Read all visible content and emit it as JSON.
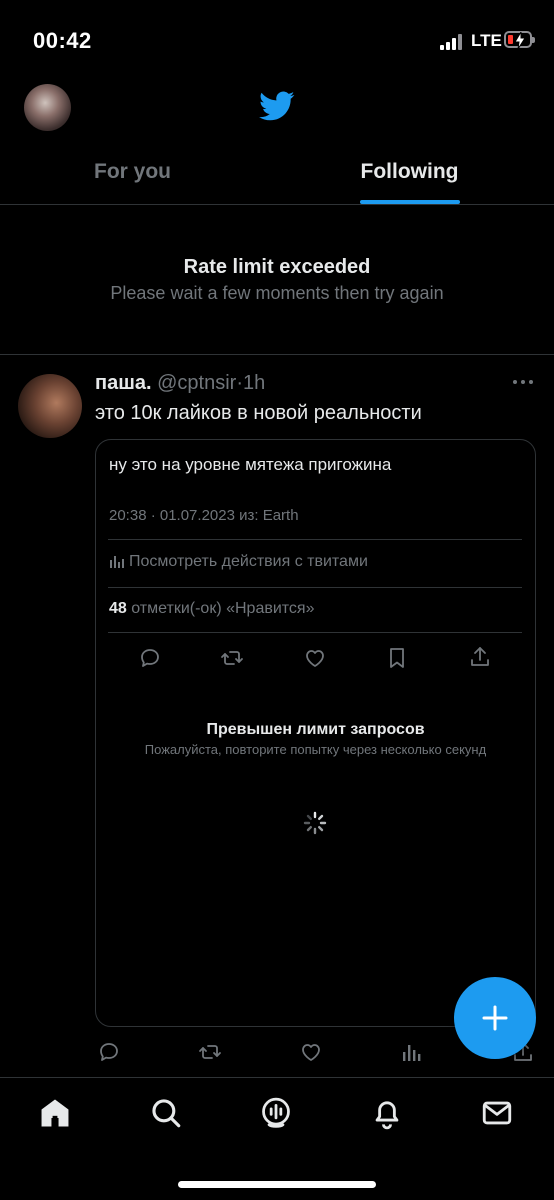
{
  "status_bar": {
    "time": "00:42",
    "network": "LTE",
    "icons": [
      "signal-icon",
      "battery-charging-icon"
    ]
  },
  "header": {
    "logo": "twitter-bird-icon",
    "avatar": "profile-avatar"
  },
  "tabs": [
    {
      "label": "For you",
      "active": false
    },
    {
      "label": "Following",
      "active": true
    }
  ],
  "rate_limit": {
    "title": "Rate limit exceeded",
    "subtitle": "Please wait a few moments then try again"
  },
  "tweet": {
    "name": "паша.",
    "handle": "@cptnsir",
    "separator": "·",
    "time": "1h",
    "text": "это 10к лайков в новой реальности",
    "card": {
      "text": "ну это на уровне мятежа пригожина",
      "meta": "20:38 · 01.07.2023 из: Earth",
      "activity": "Посмотреть действия с твитами",
      "likes_count": "48",
      "likes_label": "отметки(-ок) «Нравится»",
      "actions": [
        "reply-icon",
        "retweet-icon",
        "like-icon",
        "bookmark-icon",
        "share-icon"
      ],
      "limit_title": "Превышен лимит запросов",
      "limit_subtitle": "Пожалуйста, повторите попытку через несколько секунд"
    },
    "actions": [
      "reply-icon",
      "retweet-icon",
      "like-icon",
      "views-icon",
      "share-icon"
    ]
  },
  "nav": [
    "home-icon",
    "search-icon",
    "spaces-icon",
    "notifications-icon",
    "messages-icon"
  ],
  "colors": {
    "accent": "#1d9bf0",
    "background": "#000000",
    "muted": "#71767b",
    "divider": "#2f3336"
  }
}
